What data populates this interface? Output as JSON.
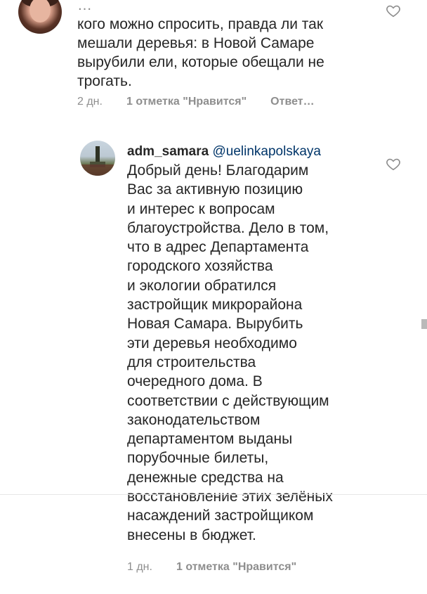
{
  "comment_1": {
    "text_partial_top": "…",
    "text": "кого можно спросить, правда ли так\nмешали деревья: в Новой Самаре\nвырубили ели, которые обещали не\nтрогать.",
    "time": "2 дн.",
    "likes": "1 отметка \"Нравится\"",
    "reply": "Ответ…"
  },
  "comment_2": {
    "username": "adm_samara",
    "mention": "@uelinkapolskaya",
    "text": "Добрый день! Благодарим\nВас за активную позицию\nи интерес к вопросам\nблагоустройства. Дело в том,\nчто в адрес Департамента\nгородского хозяйства\nи экологии обратился\nзастройщик микрорайона\nНовая Самара. Вырубить\nэти деревья необходимо\nдля строительства\nочередного дома. В\nсоответствии с действующим\nзаконодательством\nдепартаментом выданы\nпорубочные билеты,\nденежные средства на\nвосстановление этих зелёных\nнасаждений застройщиком\nвнесены в бюджет.",
    "time": "1 дн.",
    "likes": "1 отметка \"Нравится\""
  },
  "icons": {
    "like": "heart-outline-icon",
    "avatar_1": "user-avatar",
    "avatar_2": "adm-samara-avatar"
  },
  "colors": {
    "text": "#262626",
    "meta": "#8e8e8e",
    "mention": "#003569"
  }
}
